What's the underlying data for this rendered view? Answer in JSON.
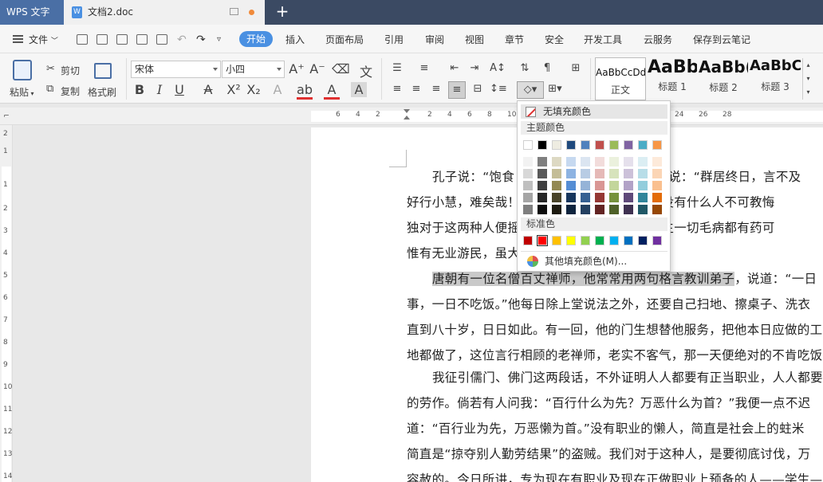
{
  "titlebar": {
    "app_name": "WPS 文字",
    "doc_tab": "文档2.doc",
    "new_tab": "+"
  },
  "menubar": {
    "file": "文件",
    "tabs": [
      "开始",
      "插入",
      "页面布局",
      "引用",
      "审阅",
      "视图",
      "章节",
      "安全",
      "开发工具",
      "云服务",
      "保存到云笔记"
    ],
    "active_tab": "开始"
  },
  "ribbon": {
    "paste": "粘贴",
    "cut": "剪切",
    "copy": "复制",
    "format_painter": "格式刷",
    "font_name": "宋体",
    "font_size": "小四",
    "styles": [
      {
        "sample": "AaBbCcDd",
        "name": "正文"
      },
      {
        "sample": "AaBb",
        "name": "标题 1"
      },
      {
        "sample": "AaBb(",
        "name": "标题 2"
      },
      {
        "sample": "AaBbC",
        "name": "标题 3"
      }
    ]
  },
  "rulers": {
    "h_numbers": [
      "6",
      "4",
      "2",
      "2",
      "4",
      "6",
      "8",
      "10",
      "12",
      "14",
      "16",
      "18",
      "20",
      "22",
      "24",
      "26",
      "28"
    ],
    "v_numbers": [
      "2",
      "1",
      "1",
      "2",
      "3",
      "4",
      "5",
      "6",
      "7",
      "8",
      "9",
      "10",
      "11",
      "12",
      "13",
      "14",
      "15",
      "16",
      "17",
      "18"
    ]
  },
  "document": {
    "lines": [
      {
        "pre": "",
        "hl": "",
        "post": "孔子说：“饱食",
        "post2": "”又说：“群居终日，言不及"
      },
      {
        "pre": "好行小慧，难矣哉！",
        "hl": "",
        "post": "",
        "post2": "心目中没有什么人不可教悔"
      },
      {
        "pre": "独对于这两种人便摇",
        "hl": "",
        "post": "",
        "post2": "可见人生一切毛病都有药可"
      },
      {
        "pre": "惟有无业游民，虽大",
        "hl": "",
        "post": "",
        "post2": ""
      },
      {
        "pre": "",
        "hl": "唐朝有一位名僧百丈禅师，他常常用两句格言教训弟子",
        "post": "，说道：“一日",
        "post2": ""
      },
      {
        "pre": "事，一日不吃饭。”他每日除上堂说法之外，还要自己扫地、擦桌子、洗衣",
        "hl": "",
        "post": "",
        "post2": ""
      },
      {
        "pre": "直到八十岁，日日如此。有一回，他的门生想替他服务，把他本日应做的工",
        "hl": "",
        "post": "",
        "post2": ""
      },
      {
        "pre": "地都做了，这位言行相顾的老禅师，老实不客气，那一天便绝对的不肯吃饭",
        "hl": "",
        "post": "",
        "post2": ""
      },
      {
        "pre": "",
        "hl": "",
        "post": "我征引儒门、佛门这两段话，不外证明人人都要有正当职业，人人都要",
        "post2": ""
      },
      {
        "pre": "的劳作。倘若有人问我：“百行什么为先？万恶什么为首？”我便一点不迟",
        "hl": "",
        "post": "",
        "post2": ""
      },
      {
        "pre": "道：“百行业为先，万恶懒为首。”没有职业的懒人，简直是社会上的蛀米",
        "hl": "",
        "post": "",
        "post2": ""
      },
      {
        "pre": "简直是“掠夺别人勤劳结果”的盗贼。我们对于这种人，是要彻底讨伐，万",
        "hl": "",
        "post": "",
        "post2": ""
      },
      {
        "pre": "容赦的。今日所讲，专为现在有职业及现在正做职业上预备的人——学生—",
        "hl": "",
        "post": "",
        "post2": ""
      }
    ]
  },
  "fill_menu": {
    "no_fill": "无填充颜色",
    "theme_colors_label": "主题颜色",
    "standard_colors_label": "标准色",
    "more_colors": "其他填充颜色(M)...",
    "theme_top": [
      "#ffffff",
      "#000000",
      "#eeece1",
      "#1f497d",
      "#4f81bd",
      "#c0504d",
      "#9bbb59",
      "#8064a2",
      "#4bacc6",
      "#f79646"
    ],
    "theme_shades": [
      [
        "#f2f2f2",
        "#7f7f7f",
        "#ddd9c3",
        "#c6d9f0",
        "#dbe5f1",
        "#f2dcdb",
        "#ebf1dd",
        "#e5e0ec",
        "#dbeef3",
        "#fdeada"
      ],
      [
        "#d8d8d8",
        "#595959",
        "#c4bd97",
        "#8db3e2",
        "#b8cce4",
        "#e5b9b7",
        "#d7e3bc",
        "#ccc1d9",
        "#b7dde8",
        "#fbd5b5"
      ],
      [
        "#bfbfbf",
        "#3f3f3f",
        "#938953",
        "#548dd4",
        "#95b3d7",
        "#d99694",
        "#c3d69b",
        "#b2a2c7",
        "#92cddc",
        "#fac08f"
      ],
      [
        "#a5a5a5",
        "#262626",
        "#494429",
        "#17365d",
        "#366092",
        "#953734",
        "#76923c",
        "#5f497a",
        "#31859b",
        "#e36c09"
      ],
      [
        "#7f7f7f",
        "#0c0c0c",
        "#1d1b10",
        "#0f243e",
        "#244061",
        "#632423",
        "#4f6128",
        "#3f3151",
        "#205867",
        "#974806"
      ]
    ],
    "standard": [
      "#c00000",
      "#ff0000",
      "#ffc000",
      "#ffff00",
      "#92d050",
      "#00b050",
      "#00b0f0",
      "#0070c0",
      "#002060",
      "#7030a0"
    ],
    "standard_selected_index": 1
  }
}
